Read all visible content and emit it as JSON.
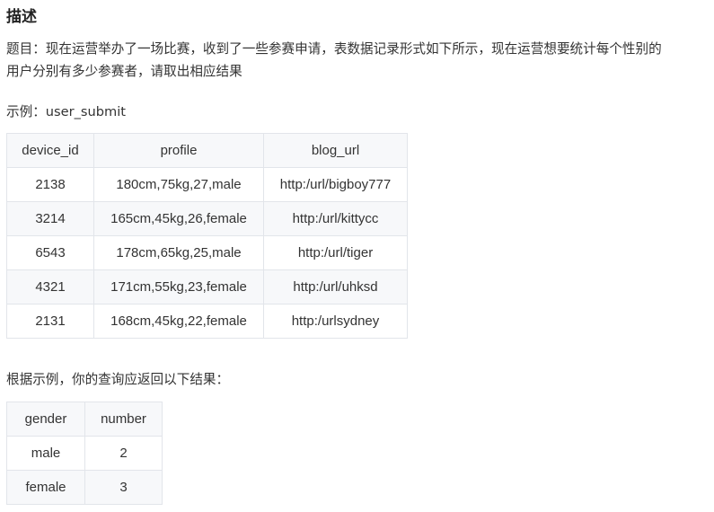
{
  "title": "描述",
  "description_line1": "题目：现在运营举办了一场比赛，收到了一些参赛申请，表数据记录形式如下所示，现在运营想要统计每个性别的",
  "description_line2": "用户分别有多少参赛者，请取出相应结果",
  "example_label": "示例：user_submit",
  "user_submit": {
    "headers": [
      "device_id",
      "profile",
      "blog_url"
    ],
    "rows": [
      [
        "2138",
        "180cm,75kg,27,male",
        "http:/url/bigboy777"
      ],
      [
        "3214",
        "165cm,45kg,26,female",
        "http:/url/kittycc"
      ],
      [
        "6543",
        "178cm,65kg,25,male",
        "http:/url/tiger"
      ],
      [
        "4321",
        "171cm,55kg,23,female",
        "http:/url/uhksd"
      ],
      [
        "2131",
        "168cm,45kg,22,female",
        "http:/urlsydney"
      ]
    ]
  },
  "result_label": "根据示例，你的查询应返回以下结果：",
  "result": {
    "headers": [
      "gender",
      "number"
    ],
    "rows": [
      [
        "male",
        "2"
      ],
      [
        "female",
        "3"
      ]
    ]
  }
}
